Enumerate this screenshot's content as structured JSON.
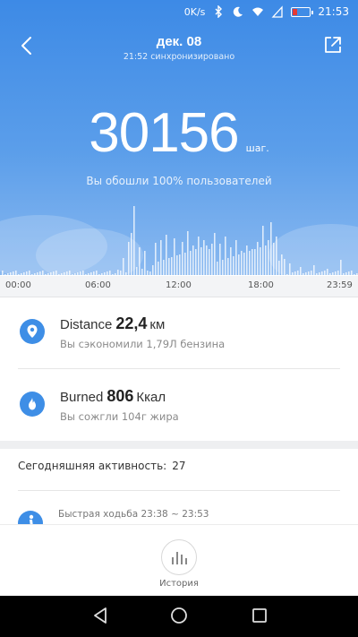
{
  "status_bar": {
    "net_speed": "0K/s",
    "time": "21:53"
  },
  "header": {
    "date": "дек. 08",
    "sync_text": "21:52 синхронизировано"
  },
  "summary": {
    "steps": "30156",
    "unit": "шаг.",
    "percent_text": "Вы обошли 100% пользователей"
  },
  "timeline": {
    "ticks": [
      "00:00",
      "06:00",
      "12:00",
      "18:00",
      "23:59"
    ]
  },
  "distance": {
    "label": "Distance",
    "value": "22,4",
    "unit": "км",
    "note": "Вы сэкономили 1,79Л бензина"
  },
  "burned": {
    "label": "Burned",
    "value": "806",
    "unit": "Ккал",
    "note": "Вы сожгли 104г жира"
  },
  "activity": {
    "label": "Сегодняшняя активность:",
    "count": "27",
    "first_item": "Быстрая ходьба 23:38 ~ 23:53"
  },
  "bottom": {
    "history_label": "История"
  },
  "colors": {
    "accent": "#3e8ee6",
    "hero_top": "#3d8ae6"
  }
}
